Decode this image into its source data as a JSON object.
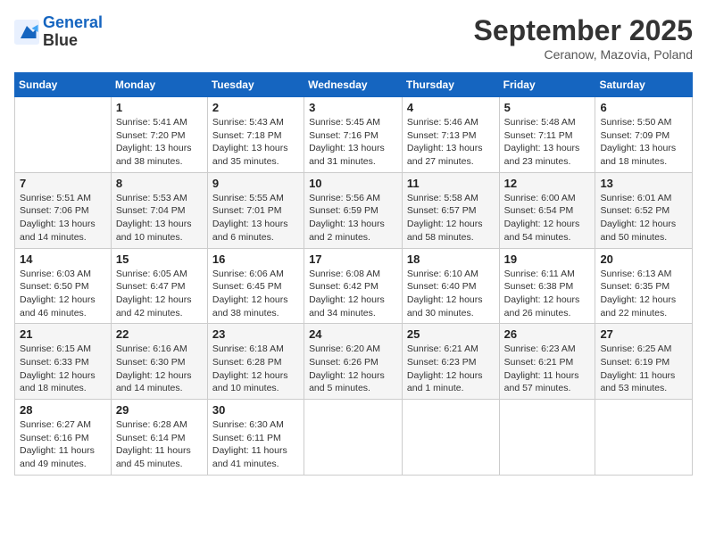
{
  "header": {
    "logo_line1": "General",
    "logo_line2": "Blue",
    "month": "September 2025",
    "location": "Ceranow, Mazovia, Poland"
  },
  "days_of_week": [
    "Sunday",
    "Monday",
    "Tuesday",
    "Wednesday",
    "Thursday",
    "Friday",
    "Saturday"
  ],
  "weeks": [
    [
      {
        "num": "",
        "info": ""
      },
      {
        "num": "1",
        "info": "Sunrise: 5:41 AM\nSunset: 7:20 PM\nDaylight: 13 hours\nand 38 minutes."
      },
      {
        "num": "2",
        "info": "Sunrise: 5:43 AM\nSunset: 7:18 PM\nDaylight: 13 hours\nand 35 minutes."
      },
      {
        "num": "3",
        "info": "Sunrise: 5:45 AM\nSunset: 7:16 PM\nDaylight: 13 hours\nand 31 minutes."
      },
      {
        "num": "4",
        "info": "Sunrise: 5:46 AM\nSunset: 7:13 PM\nDaylight: 13 hours\nand 27 minutes."
      },
      {
        "num": "5",
        "info": "Sunrise: 5:48 AM\nSunset: 7:11 PM\nDaylight: 13 hours\nand 23 minutes."
      },
      {
        "num": "6",
        "info": "Sunrise: 5:50 AM\nSunset: 7:09 PM\nDaylight: 13 hours\nand 18 minutes."
      }
    ],
    [
      {
        "num": "7",
        "info": "Sunrise: 5:51 AM\nSunset: 7:06 PM\nDaylight: 13 hours\nand 14 minutes."
      },
      {
        "num": "8",
        "info": "Sunrise: 5:53 AM\nSunset: 7:04 PM\nDaylight: 13 hours\nand 10 minutes."
      },
      {
        "num": "9",
        "info": "Sunrise: 5:55 AM\nSunset: 7:01 PM\nDaylight: 13 hours\nand 6 minutes."
      },
      {
        "num": "10",
        "info": "Sunrise: 5:56 AM\nSunset: 6:59 PM\nDaylight: 13 hours\nand 2 minutes."
      },
      {
        "num": "11",
        "info": "Sunrise: 5:58 AM\nSunset: 6:57 PM\nDaylight: 12 hours\nand 58 minutes."
      },
      {
        "num": "12",
        "info": "Sunrise: 6:00 AM\nSunset: 6:54 PM\nDaylight: 12 hours\nand 54 minutes."
      },
      {
        "num": "13",
        "info": "Sunrise: 6:01 AM\nSunset: 6:52 PM\nDaylight: 12 hours\nand 50 minutes."
      }
    ],
    [
      {
        "num": "14",
        "info": "Sunrise: 6:03 AM\nSunset: 6:50 PM\nDaylight: 12 hours\nand 46 minutes."
      },
      {
        "num": "15",
        "info": "Sunrise: 6:05 AM\nSunset: 6:47 PM\nDaylight: 12 hours\nand 42 minutes."
      },
      {
        "num": "16",
        "info": "Sunrise: 6:06 AM\nSunset: 6:45 PM\nDaylight: 12 hours\nand 38 minutes."
      },
      {
        "num": "17",
        "info": "Sunrise: 6:08 AM\nSunset: 6:42 PM\nDaylight: 12 hours\nand 34 minutes."
      },
      {
        "num": "18",
        "info": "Sunrise: 6:10 AM\nSunset: 6:40 PM\nDaylight: 12 hours\nand 30 minutes."
      },
      {
        "num": "19",
        "info": "Sunrise: 6:11 AM\nSunset: 6:38 PM\nDaylight: 12 hours\nand 26 minutes."
      },
      {
        "num": "20",
        "info": "Sunrise: 6:13 AM\nSunset: 6:35 PM\nDaylight: 12 hours\nand 22 minutes."
      }
    ],
    [
      {
        "num": "21",
        "info": "Sunrise: 6:15 AM\nSunset: 6:33 PM\nDaylight: 12 hours\nand 18 minutes."
      },
      {
        "num": "22",
        "info": "Sunrise: 6:16 AM\nSunset: 6:30 PM\nDaylight: 12 hours\nand 14 minutes."
      },
      {
        "num": "23",
        "info": "Sunrise: 6:18 AM\nSunset: 6:28 PM\nDaylight: 12 hours\nand 10 minutes."
      },
      {
        "num": "24",
        "info": "Sunrise: 6:20 AM\nSunset: 6:26 PM\nDaylight: 12 hours\nand 5 minutes."
      },
      {
        "num": "25",
        "info": "Sunrise: 6:21 AM\nSunset: 6:23 PM\nDaylight: 12 hours\nand 1 minute."
      },
      {
        "num": "26",
        "info": "Sunrise: 6:23 AM\nSunset: 6:21 PM\nDaylight: 11 hours\nand 57 minutes."
      },
      {
        "num": "27",
        "info": "Sunrise: 6:25 AM\nSunset: 6:19 PM\nDaylight: 11 hours\nand 53 minutes."
      }
    ],
    [
      {
        "num": "28",
        "info": "Sunrise: 6:27 AM\nSunset: 6:16 PM\nDaylight: 11 hours\nand 49 minutes."
      },
      {
        "num": "29",
        "info": "Sunrise: 6:28 AM\nSunset: 6:14 PM\nDaylight: 11 hours\nand 45 minutes."
      },
      {
        "num": "30",
        "info": "Sunrise: 6:30 AM\nSunset: 6:11 PM\nDaylight: 11 hours\nand 41 minutes."
      },
      {
        "num": "",
        "info": ""
      },
      {
        "num": "",
        "info": ""
      },
      {
        "num": "",
        "info": ""
      },
      {
        "num": "",
        "info": ""
      }
    ]
  ]
}
